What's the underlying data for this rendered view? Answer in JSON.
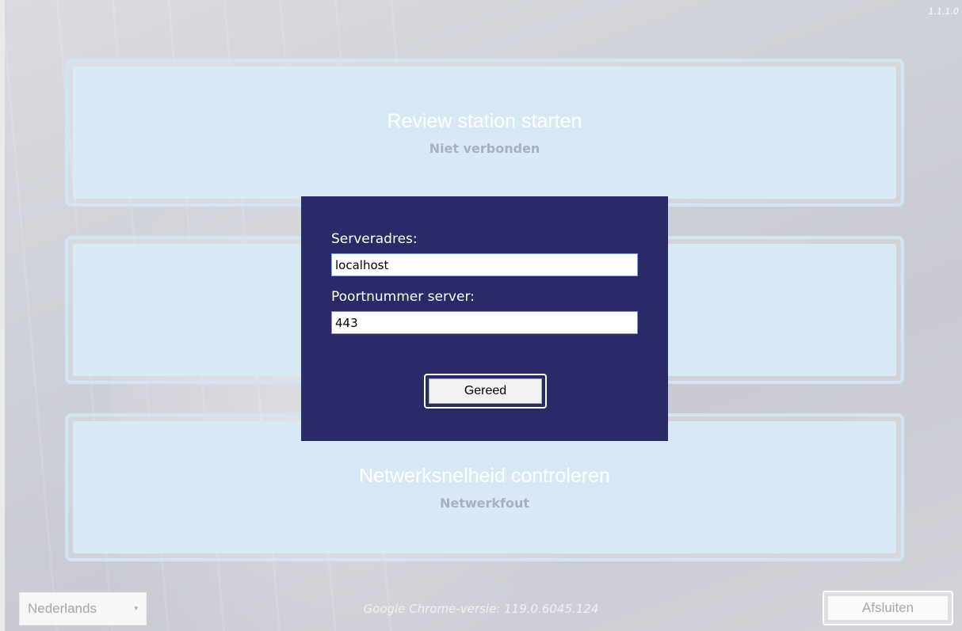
{
  "app": {
    "version": "1.1.1.0"
  },
  "tiles": [
    {
      "title": "Review station starten",
      "subtitle": "Niet verbonden"
    },
    {
      "title": "",
      "subtitle": ""
    },
    {
      "title": "Netwerksnelheid controleren",
      "subtitle": "Netwerkfout"
    }
  ],
  "dialog": {
    "server_address_label": "Serveradres:",
    "server_address_value": "localhost",
    "server_port_label": "Poortnummer server:",
    "server_port_value": "443",
    "done_label": "Gereed"
  },
  "footer": {
    "language_selected": "Nederlands",
    "chrome_version": "Google Chrome-versie:  119.0.6045.124",
    "close_label": "Afsluiten"
  },
  "colors": {
    "dialog_background": "#292a67",
    "tile_background": "#d7e9f5",
    "tile_border": "#cfe5f3"
  }
}
